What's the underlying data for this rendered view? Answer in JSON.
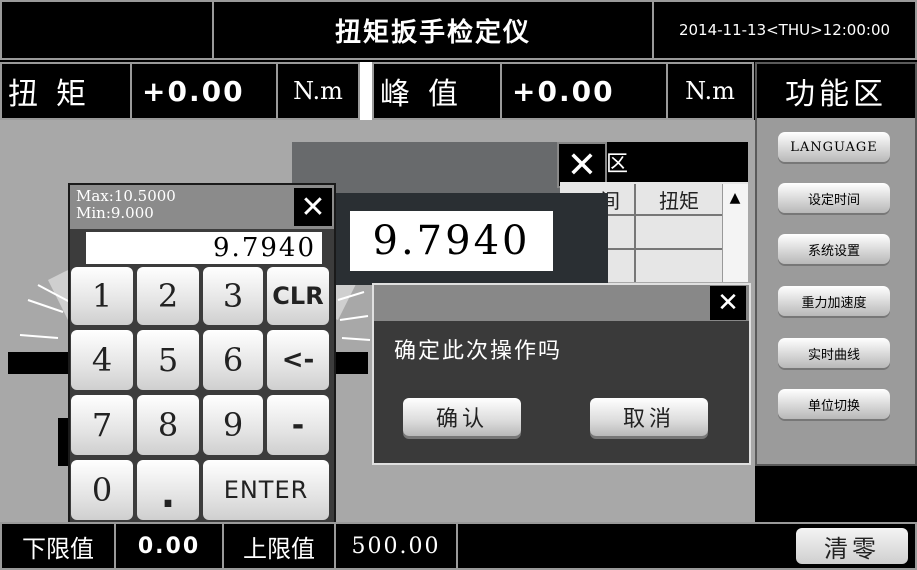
{
  "header": {
    "title": "扭矩扳手检定仪",
    "datetime": "2014-11-13<THU>12:00:00"
  },
  "measure": {
    "torque_label": "扭矩",
    "torque_value": "+0.00",
    "torque_unit": "N.m",
    "peak_label": "峰值",
    "peak_value": "+0.00",
    "peak_unit": "N.m"
  },
  "function_panel": {
    "title": "功能区",
    "buttons": [
      "LANGUAGE",
      "设定时间",
      "系统设置",
      "重力加速度",
      "实时曲线",
      "单位切换"
    ]
  },
  "background_window": {
    "title_fragment": "区",
    "col1_fragment": "间",
    "col2": "扭矩"
  },
  "keypad": {
    "max": "Max:10.5000",
    "min": "Min:9.000",
    "display": "9.7940",
    "keys": [
      "1",
      "2",
      "3",
      "CLR",
      "4",
      "5",
      "6",
      "<-",
      "7",
      "8",
      "9",
      "-",
      "0",
      ".",
      "ENTER"
    ]
  },
  "value_popup": {
    "value": "9.7940"
  },
  "confirm": {
    "message": "确定此次操作吗",
    "ok": "确认",
    "cancel": "取消"
  },
  "bottom": {
    "lower_label": "下限值",
    "lower_value": "0.00",
    "upper_label": "上限值",
    "upper_value": "500.00",
    "clear": "清零"
  },
  "icons": {
    "close": "close-icon",
    "scroll_up": "arrow-up-icon"
  }
}
